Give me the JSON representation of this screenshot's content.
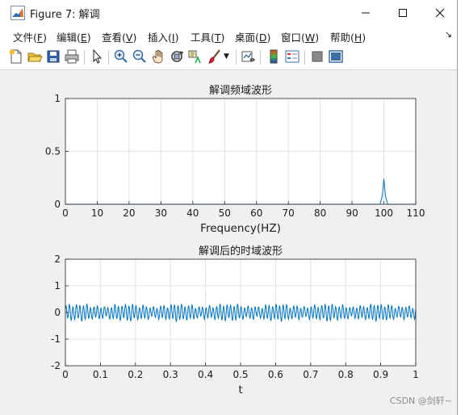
{
  "window": {
    "title": "Figure 7: 解调"
  },
  "menu": {
    "items": [
      {
        "label": "文件(",
        "key": "F",
        "tail": ")"
      },
      {
        "label": "编辑(",
        "key": "E",
        "tail": ")"
      },
      {
        "label": "查看(",
        "key": "V",
        "tail": ")"
      },
      {
        "label": "插入(",
        "key": "I",
        "tail": ")"
      },
      {
        "label": "工具(",
        "key": "T",
        "tail": ")"
      },
      {
        "label": "桌面(",
        "key": "D",
        "tail": ")"
      },
      {
        "label": "窗口(",
        "key": "W",
        "tail": ")"
      },
      {
        "label": "帮助(",
        "key": "H",
        "tail": ")"
      }
    ]
  },
  "toolbar": {
    "icons": [
      "new-figure-icon",
      "open-file-icon",
      "save-icon",
      "print-icon",
      "pointer-icon",
      "zoom-in-icon",
      "zoom-out-icon",
      "pan-icon",
      "rotate-3d-icon",
      "data-cursor-icon",
      "brush-icon",
      "brush-dropdown-icon",
      "link-plot-icon",
      "colorbar-icon",
      "legend-icon",
      "hide-plot-tools-icon",
      "show-plot-tools-icon"
    ]
  },
  "chart_data": [
    {
      "type": "line",
      "title": "解调频域波形",
      "xlabel": "Frequency(HZ)",
      "ylabel": "",
      "xlim": [
        0,
        110
      ],
      "ylim": [
        0,
        1
      ],
      "xticks": [
        "0",
        "10",
        "20",
        "30",
        "40",
        "50",
        "60",
        "70",
        "80",
        "90",
        "100",
        "110"
      ],
      "yticks": [
        "0",
        "0.5",
        "1"
      ],
      "grid": true,
      "color": "#0072bd",
      "series": [
        {
          "x": [
            0,
            98.8,
            99.5,
            100.0,
            100.5,
            101.2,
            110
          ],
          "y": [
            0,
            0,
            0.08,
            0.24,
            0.08,
            0,
            0
          ]
        }
      ]
    },
    {
      "type": "line",
      "title": "解调后的时域波形",
      "xlabel": "t",
      "ylabel": "",
      "xlim": [
        0,
        1
      ],
      "ylim": [
        -2,
        2
      ],
      "xticks": [
        "0",
        "0.1",
        "0.2",
        "0.3",
        "0.4",
        "0.5",
        "0.6",
        "0.7",
        "0.8",
        "0.9",
        "1"
      ],
      "yticks": [
        "-2",
        "-1",
        "0",
        "1",
        "2"
      ],
      "grid": true,
      "color": "#0072bd",
      "series": [
        {
          "x_range": [
            0,
            1
          ],
          "amplitude": 0.28,
          "cycles": 100,
          "offset": 0
        }
      ]
    }
  ],
  "watermark": "CSDN @剑轩~"
}
